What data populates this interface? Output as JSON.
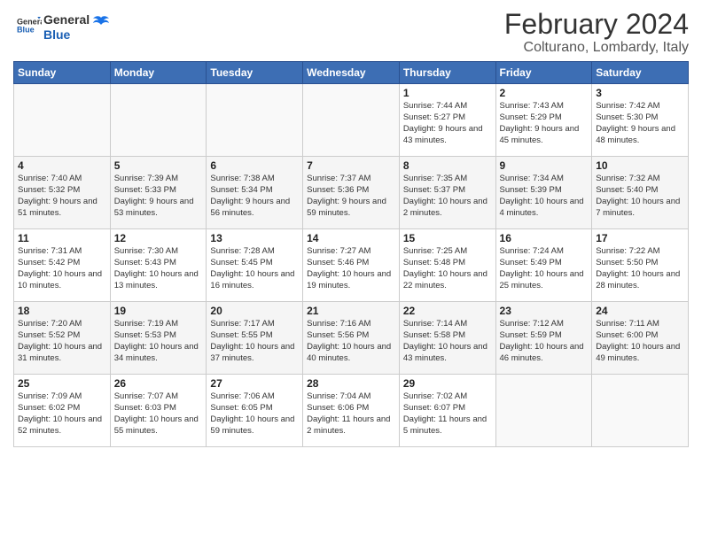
{
  "header": {
    "logo": {
      "line1": "General",
      "line2": "Blue"
    },
    "title": "February 2024",
    "subtitle": "Colturano, Lombardy, Italy"
  },
  "weekdays": [
    "Sunday",
    "Monday",
    "Tuesday",
    "Wednesday",
    "Thursday",
    "Friday",
    "Saturday"
  ],
  "weeks": [
    [
      {
        "day": "",
        "info": ""
      },
      {
        "day": "",
        "info": ""
      },
      {
        "day": "",
        "info": ""
      },
      {
        "day": "",
        "info": ""
      },
      {
        "day": "1",
        "info": "Sunrise: 7:44 AM\nSunset: 5:27 PM\nDaylight: 9 hours\nand 43 minutes."
      },
      {
        "day": "2",
        "info": "Sunrise: 7:43 AM\nSunset: 5:29 PM\nDaylight: 9 hours\nand 45 minutes."
      },
      {
        "day": "3",
        "info": "Sunrise: 7:42 AM\nSunset: 5:30 PM\nDaylight: 9 hours\nand 48 minutes."
      }
    ],
    [
      {
        "day": "4",
        "info": "Sunrise: 7:40 AM\nSunset: 5:32 PM\nDaylight: 9 hours\nand 51 minutes."
      },
      {
        "day": "5",
        "info": "Sunrise: 7:39 AM\nSunset: 5:33 PM\nDaylight: 9 hours\nand 53 minutes."
      },
      {
        "day": "6",
        "info": "Sunrise: 7:38 AM\nSunset: 5:34 PM\nDaylight: 9 hours\nand 56 minutes."
      },
      {
        "day": "7",
        "info": "Sunrise: 7:37 AM\nSunset: 5:36 PM\nDaylight: 9 hours\nand 59 minutes."
      },
      {
        "day": "8",
        "info": "Sunrise: 7:35 AM\nSunset: 5:37 PM\nDaylight: 10 hours\nand 2 minutes."
      },
      {
        "day": "9",
        "info": "Sunrise: 7:34 AM\nSunset: 5:39 PM\nDaylight: 10 hours\nand 4 minutes."
      },
      {
        "day": "10",
        "info": "Sunrise: 7:32 AM\nSunset: 5:40 PM\nDaylight: 10 hours\nand 7 minutes."
      }
    ],
    [
      {
        "day": "11",
        "info": "Sunrise: 7:31 AM\nSunset: 5:42 PM\nDaylight: 10 hours\nand 10 minutes."
      },
      {
        "day": "12",
        "info": "Sunrise: 7:30 AM\nSunset: 5:43 PM\nDaylight: 10 hours\nand 13 minutes."
      },
      {
        "day": "13",
        "info": "Sunrise: 7:28 AM\nSunset: 5:45 PM\nDaylight: 10 hours\nand 16 minutes."
      },
      {
        "day": "14",
        "info": "Sunrise: 7:27 AM\nSunset: 5:46 PM\nDaylight: 10 hours\nand 19 minutes."
      },
      {
        "day": "15",
        "info": "Sunrise: 7:25 AM\nSunset: 5:48 PM\nDaylight: 10 hours\nand 22 minutes."
      },
      {
        "day": "16",
        "info": "Sunrise: 7:24 AM\nSunset: 5:49 PM\nDaylight: 10 hours\nand 25 minutes."
      },
      {
        "day": "17",
        "info": "Sunrise: 7:22 AM\nSunset: 5:50 PM\nDaylight: 10 hours\nand 28 minutes."
      }
    ],
    [
      {
        "day": "18",
        "info": "Sunrise: 7:20 AM\nSunset: 5:52 PM\nDaylight: 10 hours\nand 31 minutes."
      },
      {
        "day": "19",
        "info": "Sunrise: 7:19 AM\nSunset: 5:53 PM\nDaylight: 10 hours\nand 34 minutes."
      },
      {
        "day": "20",
        "info": "Sunrise: 7:17 AM\nSunset: 5:55 PM\nDaylight: 10 hours\nand 37 minutes."
      },
      {
        "day": "21",
        "info": "Sunrise: 7:16 AM\nSunset: 5:56 PM\nDaylight: 10 hours\nand 40 minutes."
      },
      {
        "day": "22",
        "info": "Sunrise: 7:14 AM\nSunset: 5:58 PM\nDaylight: 10 hours\nand 43 minutes."
      },
      {
        "day": "23",
        "info": "Sunrise: 7:12 AM\nSunset: 5:59 PM\nDaylight: 10 hours\nand 46 minutes."
      },
      {
        "day": "24",
        "info": "Sunrise: 7:11 AM\nSunset: 6:00 PM\nDaylight: 10 hours\nand 49 minutes."
      }
    ],
    [
      {
        "day": "25",
        "info": "Sunrise: 7:09 AM\nSunset: 6:02 PM\nDaylight: 10 hours\nand 52 minutes."
      },
      {
        "day": "26",
        "info": "Sunrise: 7:07 AM\nSunset: 6:03 PM\nDaylight: 10 hours\nand 55 minutes."
      },
      {
        "day": "27",
        "info": "Sunrise: 7:06 AM\nSunset: 6:05 PM\nDaylight: 10 hours\nand 59 minutes."
      },
      {
        "day": "28",
        "info": "Sunrise: 7:04 AM\nSunset: 6:06 PM\nDaylight: 11 hours\nand 2 minutes."
      },
      {
        "day": "29",
        "info": "Sunrise: 7:02 AM\nSunset: 6:07 PM\nDaylight: 11 hours\nand 5 minutes."
      },
      {
        "day": "",
        "info": ""
      },
      {
        "day": "",
        "info": ""
      }
    ]
  ]
}
